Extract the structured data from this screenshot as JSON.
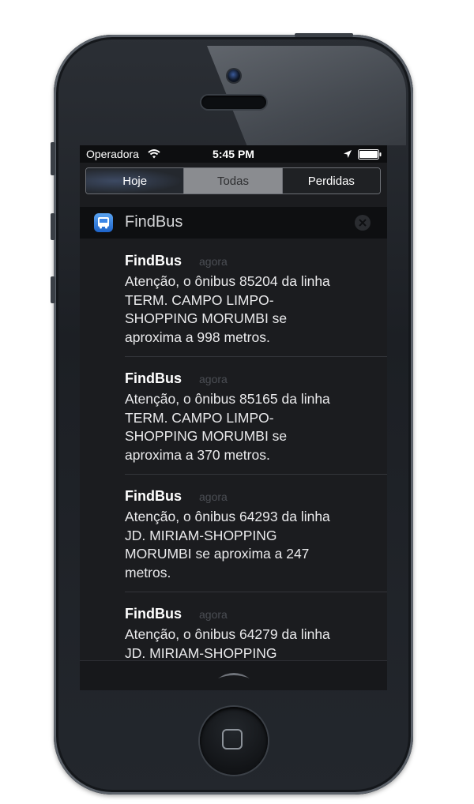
{
  "status_bar": {
    "carrier": "Operadora",
    "time": "5:45 PM",
    "icons": [
      "wifi-icon",
      "location-icon",
      "battery-icon"
    ]
  },
  "tabs": [
    {
      "label": "Hoje",
      "selected": false
    },
    {
      "label": "Todas",
      "selected": true
    },
    {
      "label": "Perdidas",
      "selected": false
    }
  ],
  "app_group": {
    "name": "FindBus",
    "icon": "bus-icon",
    "clear_icon": "close-icon"
  },
  "notifications": [
    {
      "app": "FindBus",
      "time": "agora",
      "body": "Atenção, o ônibus 85204 da linha\nTERM.  CAMPO LIMPO-\nSHOPPING MORUMBI se\naproxima a 998 metros."
    },
    {
      "app": "FindBus",
      "time": "agora",
      "body": "Atenção, o ônibus 85165 da linha\nTERM.  CAMPO LIMPO-\nSHOPPING MORUMBI se\naproxima a 370 metros."
    },
    {
      "app": "FindBus",
      "time": "agora",
      "body": "Atenção, o ônibus 64293 da linha\nJD. MIRIAM-SHOPPING\nMORUMBI se aproxima a 247\nmetros."
    },
    {
      "app": "FindBus",
      "time": "agora",
      "body": "Atenção, o ônibus 64279 da linha\nJD. MIRIAM-SHOPPING"
    }
  ],
  "bottom": {
    "icon": "grabber-icon"
  },
  "colors": {
    "accent_blue": "#2d7fe0",
    "selected_tab": "#8a8c90"
  }
}
